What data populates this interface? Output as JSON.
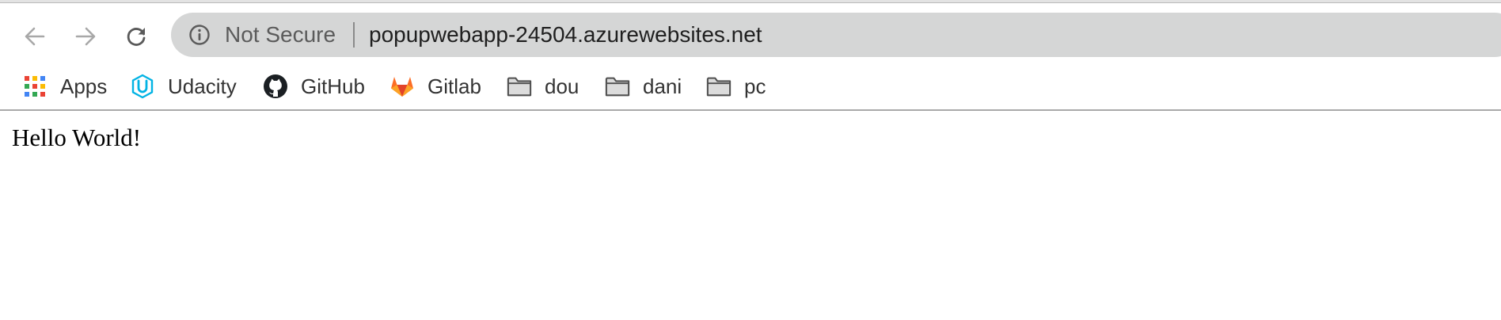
{
  "browser": {
    "nav": {
      "back_icon": "arrow-left-icon",
      "forward_icon": "arrow-right-icon",
      "reload_icon": "reload-icon"
    },
    "omnibox": {
      "security_icon": "info-circle-icon",
      "security_label": "Not Secure",
      "url": "popupwebapp-24504.azurewebsites.net"
    },
    "bookmarks": [
      {
        "label": "Apps",
        "icon": "apps-grid-icon"
      },
      {
        "label": "Udacity",
        "icon": "udacity-logo-icon"
      },
      {
        "label": "GitHub",
        "icon": "github-logo-icon"
      },
      {
        "label": "Gitlab",
        "icon": "gitlab-logo-icon"
      },
      {
        "label": "dou",
        "icon": "folder-icon"
      },
      {
        "label": "dani",
        "icon": "folder-icon"
      },
      {
        "label": "pc",
        "icon": "folder-icon"
      }
    ]
  },
  "page": {
    "body_text": "Hello World!"
  },
  "colors": {
    "omnibox_background": "#d5d6d6",
    "udacity_blue": "#02b3e4",
    "gitlab_orange": "#e24329"
  }
}
